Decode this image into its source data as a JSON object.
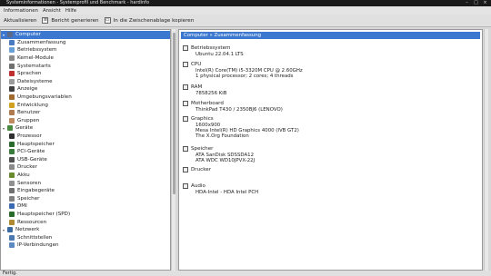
{
  "window": {
    "title": "Systeminformationen - Systemprofil und Benchmark - hardinfo"
  },
  "menu": {
    "items": [
      "Informationen",
      "Ansicht",
      "Hilfe"
    ]
  },
  "toolbar": {
    "refresh_label": "Aktualisieren",
    "report_label": "Bericht generieren",
    "copy_label": "In die Zwischenablage kopieren"
  },
  "tree": {
    "items": [
      {
        "label": "Computer",
        "level": 0,
        "color": "#5a6a88",
        "selected": true,
        "expanded": true
      },
      {
        "label": "Zusammenfassung",
        "level": 1,
        "color": "#4a7ac0"
      },
      {
        "label": "Betriebssystem",
        "level": 1,
        "color": "#6aa0d8"
      },
      {
        "label": "Kernel-Module",
        "level": 1,
        "color": "#8a8a8a"
      },
      {
        "label": "Systemstarts",
        "level": 1,
        "color": "#707070"
      },
      {
        "label": "Sprachen",
        "level": 1,
        "color": "#c03030"
      },
      {
        "label": "Dateisysteme",
        "level": 1,
        "color": "#9a9a9a"
      },
      {
        "label": "Anzeige",
        "level": 1,
        "color": "#404040"
      },
      {
        "label": "Umgebungsvariablen",
        "level": 1,
        "color": "#a06a30"
      },
      {
        "label": "Entwicklung",
        "level": 1,
        "color": "#d0a020"
      },
      {
        "label": "Benutzer",
        "level": 1,
        "color": "#b07a50"
      },
      {
        "label": "Gruppen",
        "level": 1,
        "color": "#c08a60"
      },
      {
        "label": "Geräte",
        "level": 0,
        "color": "#4a8a40",
        "expanded": true
      },
      {
        "label": "Prozessor",
        "level": 1,
        "color": "#303030"
      },
      {
        "label": "Hauptspeicher",
        "level": 1,
        "color": "#2a6a2a"
      },
      {
        "label": "PCI-Geräte",
        "level": 1,
        "color": "#3a7a3a"
      },
      {
        "label": "USB-Geräte",
        "level": 1,
        "color": "#505050"
      },
      {
        "label": "Drucker",
        "level": 1,
        "color": "#8a8a8a"
      },
      {
        "label": "Akku",
        "level": 1,
        "color": "#6a8a30"
      },
      {
        "label": "Sensoren",
        "level": 1,
        "color": "#909090"
      },
      {
        "label": "Eingabegeräte",
        "level": 1,
        "color": "#707070"
      },
      {
        "label": "Speicher",
        "level": 1,
        "color": "#808080"
      },
      {
        "label": "DMI",
        "level": 1,
        "color": "#3a6ab0"
      },
      {
        "label": "Hauptspeicher (SPD)",
        "level": 1,
        "color": "#2a6a2a"
      },
      {
        "label": "Ressourcen",
        "level": 1,
        "color": "#b08a30"
      },
      {
        "label": "Netzwerk",
        "level": 0,
        "color": "#3a6aa0",
        "expanded": true
      },
      {
        "label": "Schnittstellen",
        "level": 1,
        "color": "#4a7ab0"
      },
      {
        "label": "IP-Verbindungen",
        "level": 1,
        "color": "#5a8ac0"
      }
    ]
  },
  "detail": {
    "header": "Computer » Zusammenfassung",
    "sections": [
      {
        "icon": "os-icon",
        "title": "Betriebssystem",
        "lines": [
          "Ubuntu 22.04.1 LTS"
        ]
      },
      {
        "icon": "cpu-icon",
        "title": "CPU",
        "lines": [
          "Intel(R) Core(TM) i5-3320M CPU @ 2.60GHz",
          "1 physical processor; 2 cores; 4 threads"
        ]
      },
      {
        "icon": "ram-icon",
        "title": "RAM",
        "lines": [
          "7858256 KiB"
        ]
      },
      {
        "icon": "motherboard-icon",
        "title": "Motherboard",
        "lines": [
          "ThinkPad T430 / 2350BJ6 (LENOVO)"
        ]
      },
      {
        "icon": "graphics-icon",
        "title": "Graphics",
        "lines": [
          "1600x900",
          "Mesa Intel(R) HD Graphics 4000 (IVB GT2)",
          "The X.Org Foundation"
        ]
      },
      {
        "icon": "storage-icon",
        "title": "Speicher",
        "lines": [
          "ATA SanDisk SDSSDA12",
          "ATA WDC WD10JPVX-22J"
        ]
      },
      {
        "icon": "printer-icon",
        "title": "Drucker",
        "lines": []
      },
      {
        "icon": "audio-icon",
        "title": "Audio",
        "lines": [
          "HDA-Intel - HDA Intel PCH"
        ]
      }
    ]
  },
  "status": {
    "text": "Fertig."
  }
}
